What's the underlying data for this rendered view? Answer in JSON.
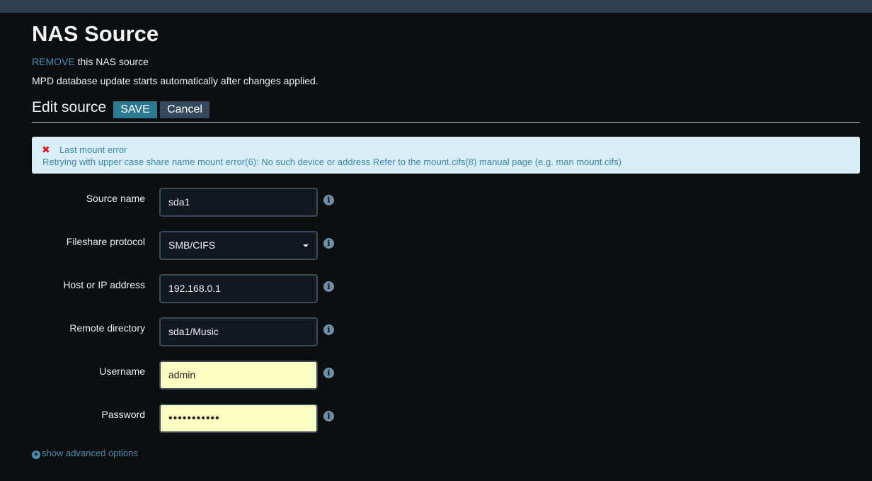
{
  "header": {
    "title": "NAS Source"
  },
  "remove": {
    "link": "REMOVE",
    "rest": " this NAS source"
  },
  "note": "MPD database update starts automatically after changes applied.",
  "section": {
    "title": "Edit source",
    "save_label": "SAVE",
    "cancel_label": "Cancel"
  },
  "alert": {
    "icon": "close-icon",
    "title": "Last mount error",
    "message": "Retrying with upper case share name mount error(6): No such device or address Refer to the mount.cifs(8) manual page (e.g. man mount.cifs)",
    "color": "#3a87ad"
  },
  "form": {
    "source_name": {
      "label": "Source name",
      "value": "sda1"
    },
    "protocol": {
      "label": "Fileshare protocol",
      "value": "SMB/CIFS"
    },
    "host": {
      "label": "Host or IP address",
      "value": "192.168.0.1"
    },
    "remote_dir": {
      "label": "Remote directory",
      "value": "sda1/Music"
    },
    "username": {
      "label": "Username",
      "value": "admin"
    },
    "password": {
      "label": "Password",
      "value": "•••••••••••"
    }
  },
  "info_icon": "i",
  "advanced": {
    "label": "show advanced options",
    "icon": "plus-circle-icon"
  },
  "colors": {
    "accent": "#2c7a92",
    "link": "#4a8eb4",
    "topbar": "#2c3e50"
  }
}
